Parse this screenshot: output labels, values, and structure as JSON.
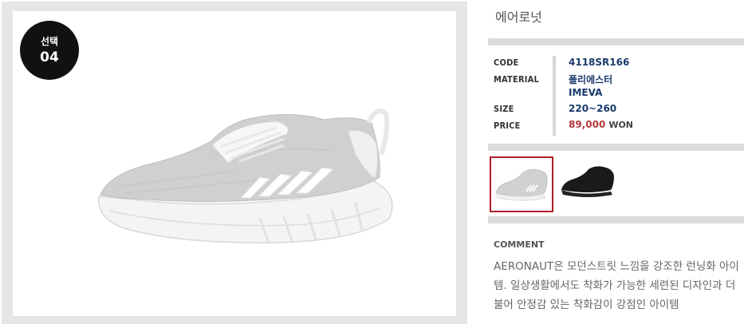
{
  "badge": {
    "line1": "선택",
    "line2": "04"
  },
  "product": {
    "name": "에어로넛"
  },
  "specs": {
    "code_label": "CODE",
    "code": "4118SR166",
    "material_label": "MATERIAL",
    "material_1": "폴리에스터",
    "material_2": "IMEVA",
    "size_label": "SIZE",
    "size": "220~260",
    "price_label": "PRICE",
    "price": "89,000",
    "currency": "WON"
  },
  "thumbnails": [
    {
      "color": "white-gray",
      "selected": true
    },
    {
      "color": "black",
      "selected": false
    }
  ],
  "comment": {
    "title": "COMMENT",
    "text": "AERONAUT은 모던스트릿 느낌을 강조한 런닝화 아이템. 일상생활에서도 착화가 가능한 세련된 디자인과 더불어 안정감 있는 착화감이 강점인 아이템"
  }
}
